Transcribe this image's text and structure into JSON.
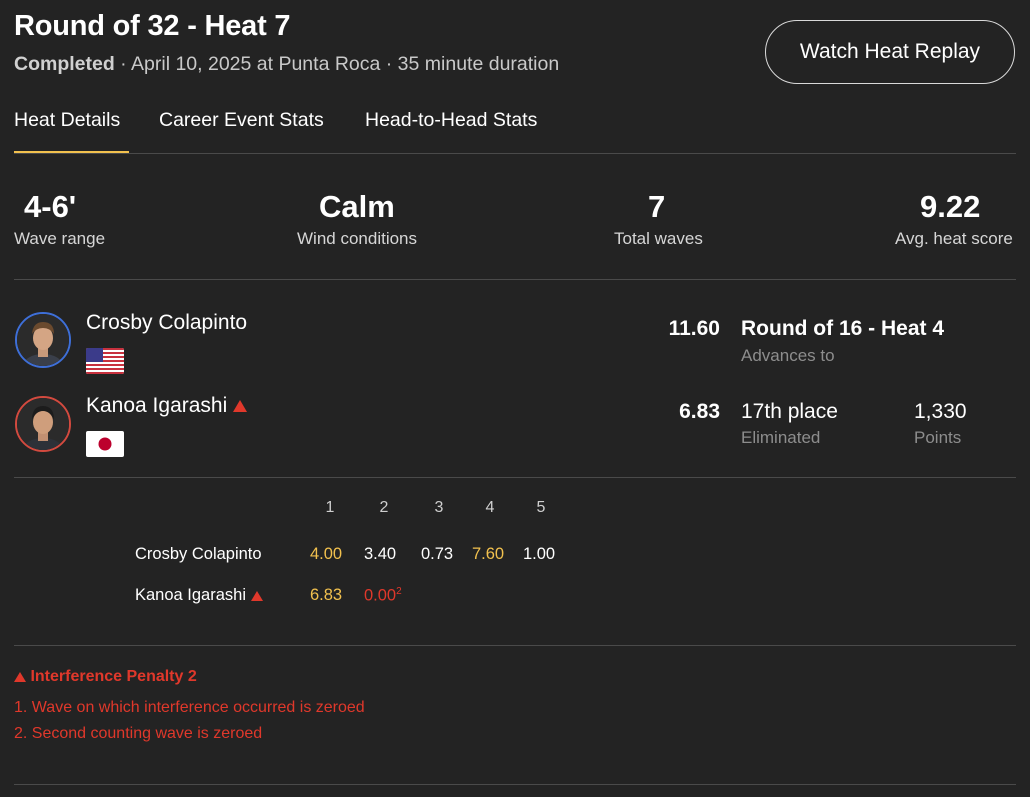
{
  "header": {
    "title": "Round of 32 - Heat 7",
    "status": "Completed",
    "details": " · April 10, 2025 at Punta Roca · 35 minute duration",
    "replay_button": "Watch Heat Replay"
  },
  "tabs": [
    {
      "label": "Heat Details",
      "active": true
    },
    {
      "label": "Career Event Stats",
      "active": false
    },
    {
      "label": "Head-to-Head Stats",
      "active": false
    }
  ],
  "stats": [
    {
      "value": "4-6'",
      "label": "Wave range"
    },
    {
      "value": "Calm",
      "label": "Wind conditions"
    },
    {
      "value": "7",
      "label": "Total waves"
    },
    {
      "value": "9.22",
      "label": "Avg. heat score"
    }
  ],
  "surfers": [
    {
      "name": "Crosby Colapinto",
      "flag": "usa-flag-icon",
      "jersey_color": "#3e6fd8",
      "score": "11.60",
      "result": "Round of 16 - Heat 4",
      "result_sub": "Advances to",
      "points": "",
      "points_label": ""
    },
    {
      "name": "Kanoa Igarashi",
      "flag": "japan-flag-icon",
      "jersey_color": "#d34a3f",
      "penalty_icon": "warning-triangle-icon",
      "score": "6.83",
      "result": "17th place",
      "result_sub": "Eliminated",
      "points": "1,330",
      "points_label": "Points"
    }
  ],
  "wave_table": {
    "headers": [
      "1",
      "2",
      "3",
      "4",
      "5"
    ],
    "rows": [
      {
        "name": "Crosby Colapinto",
        "scores": [
          "4.00",
          "3.40",
          "0.73",
          "7.60",
          "1.00"
        ]
      },
      {
        "name": "Kanoa Igarashi",
        "scores": [
          "6.83",
          "0.00"
        ],
        "penalty_mark": "2"
      }
    ]
  },
  "penalty": {
    "title": "Interference Penalty 2",
    "lines": [
      "1. Wave on which interference occurred is zeroed",
      "2. Second counting wave is zeroed"
    ]
  },
  "colors": {
    "background": "#232323",
    "counting_score": "#f2c14e",
    "penalty": "#e0382b",
    "tab_underline": "#f2c14e"
  }
}
